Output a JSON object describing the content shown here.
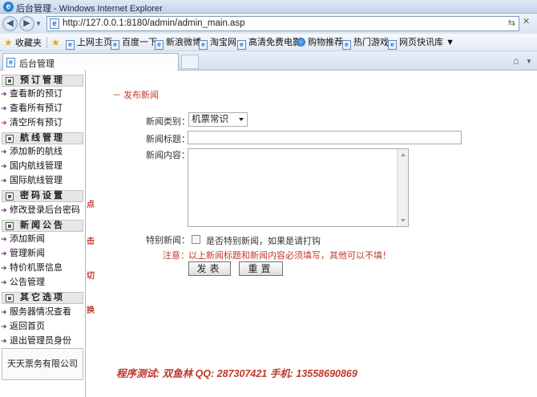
{
  "window": {
    "title": "后台管理 - Windows Internet Explorer"
  },
  "address": {
    "url": "http://127.0.0.1:8180/admin/admin_main.asp"
  },
  "favorites": {
    "label": "收藏夹",
    "items": [
      "上网主页",
      "百度一下",
      "新浪微博",
      "淘宝网",
      "高清免费电影",
      "购物推荐",
      "热门游戏",
      "网页快讯库"
    ]
  },
  "tab": {
    "label": "后台管理"
  },
  "sidebar": {
    "sections": [
      {
        "title": "预订管理",
        "items": [
          "查看新的预订",
          "查看所有预订",
          "清空所有预订"
        ]
      },
      {
        "title": "航线管理",
        "items": [
          "添加新的航线",
          "国内航线管理",
          "国际航线管理"
        ]
      },
      {
        "title": "密码设置",
        "items": [
          "修改登录后台密码"
        ]
      },
      {
        "title": "新闻公告",
        "items": [
          "添加新闻",
          "管理新闻",
          "特价机票信息",
          "公告管理"
        ]
      },
      {
        "title": "其它选项",
        "items": [
          "服务器情况查看",
          "返回首页",
          "退出管理员身份"
        ]
      }
    ],
    "footer": "天天票务有限公司"
  },
  "splitter": {
    "chars": [
      "点",
      "击",
      "切",
      "换"
    ]
  },
  "main": {
    "breadcrumb": "－ 发布新闻",
    "form": {
      "category_label": "新闻类别：",
      "category_value": "机票常识",
      "title_label": "新闻标题：",
      "title_value": "",
      "content_label": "新闻内容：",
      "content_value": "",
      "special_label": "特别新闻：",
      "special_checkbox_text": "是否特别新闻，如果是请打钩",
      "note_label": "注意：",
      "note_text": "以上新闻标题和新闻内容必须填写，其他可以不填！",
      "submit_label": "发表",
      "reset_label": "重置"
    },
    "signature": "程序测试: 双鱼林   QQ: 287307421   手机: 13558690869"
  }
}
